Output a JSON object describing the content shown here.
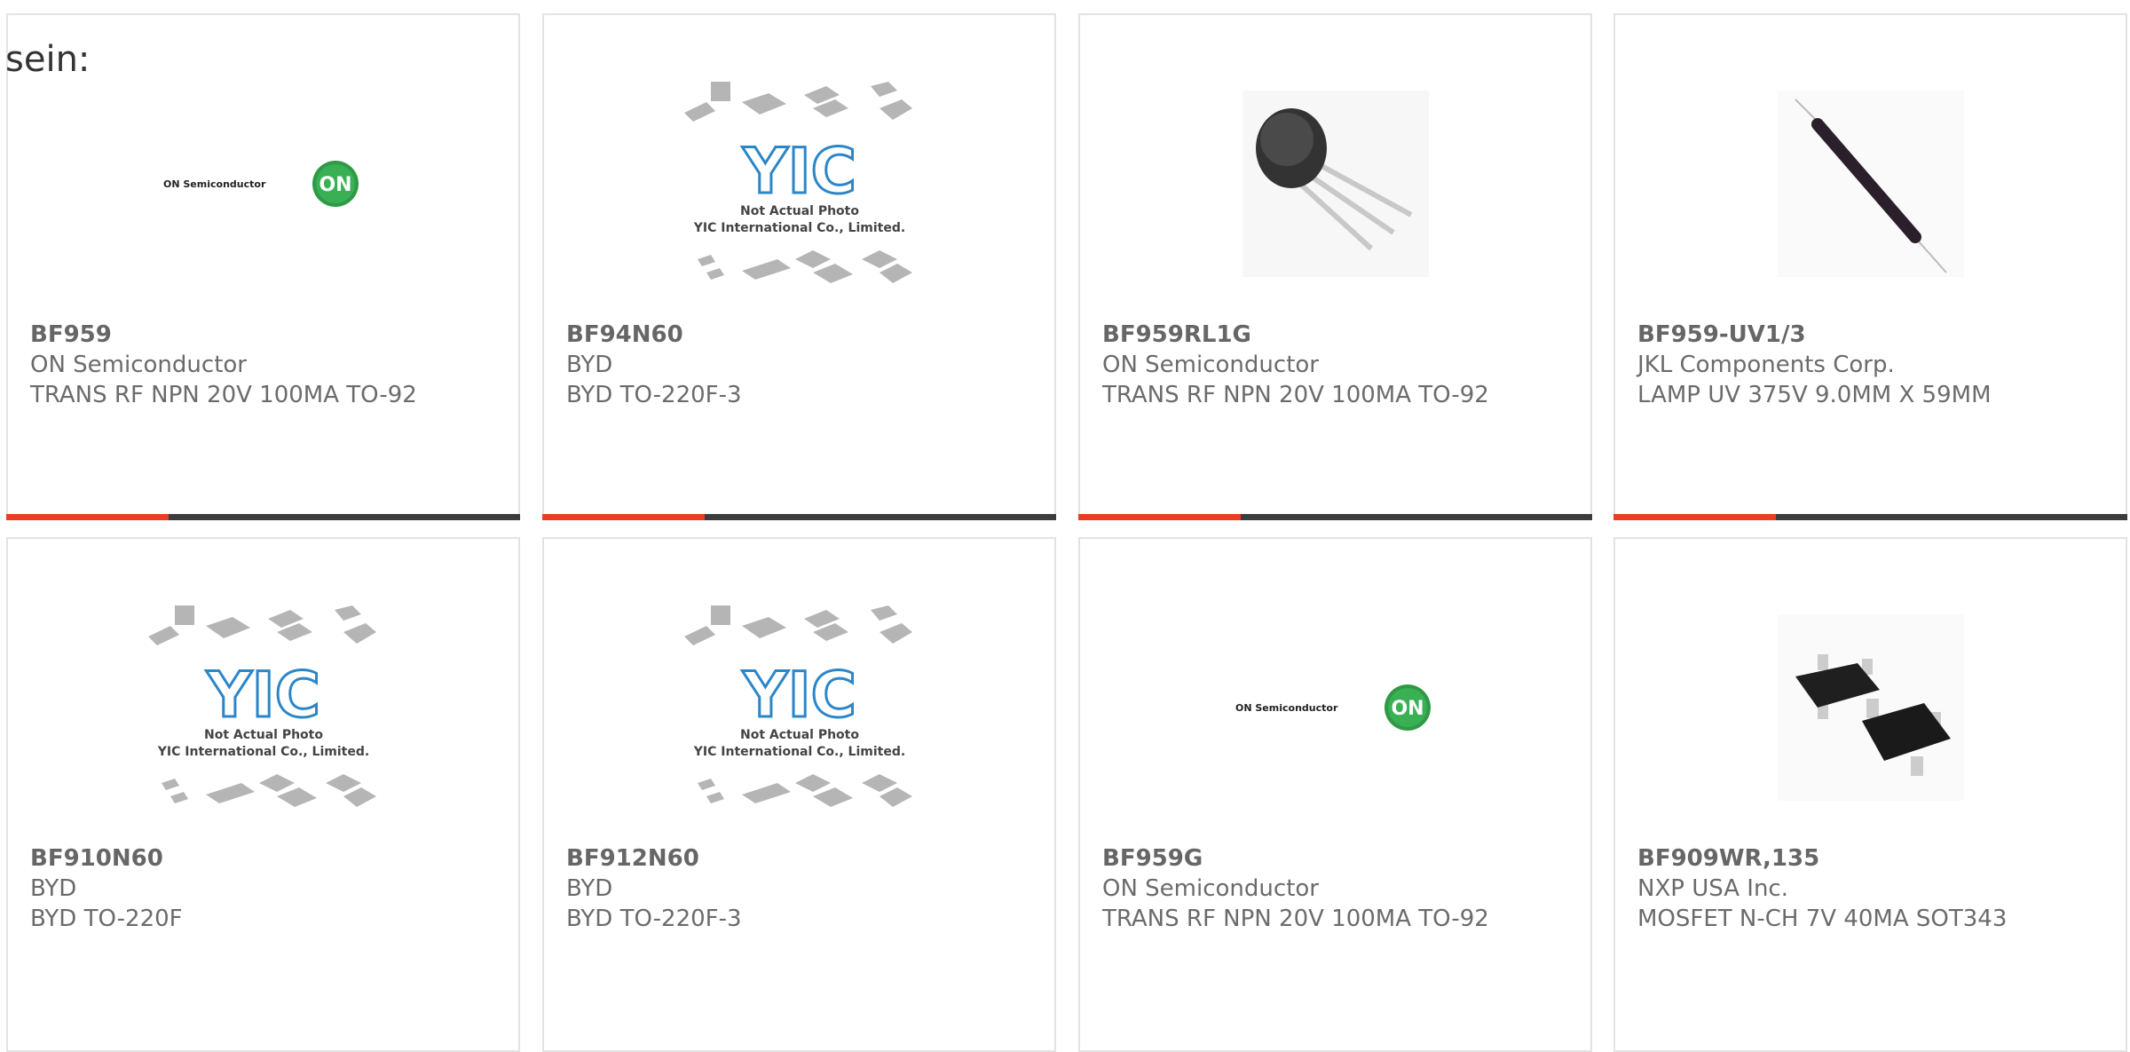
{
  "intro_text": "sein:",
  "accent_color": "#e8401c",
  "bar_color": "#3c3c3c",
  "products": [
    {
      "part": "BF959",
      "manufacturer": "ON Semiconductor",
      "description": "TRANS RF NPN 20V 100MA TO-92",
      "image": "on-semiconductor-logo"
    },
    {
      "part": "BF94N60",
      "manufacturer": "BYD",
      "description": "BYD TO-220F-3",
      "image": "yic-placeholder"
    },
    {
      "part": "BF959RL1G",
      "manufacturer": "ON Semiconductor",
      "description": "TRANS RF NPN 20V 100MA TO-92",
      "image": "to92-transistor"
    },
    {
      "part": "BF959-UV1/3",
      "manufacturer": "JKL Components Corp.",
      "description": "LAMP UV 375V 9.0MM X 59MM",
      "image": "uv-lamp"
    },
    {
      "part": "BF910N60",
      "manufacturer": "BYD",
      "description": "BYD TO-220F",
      "image": "yic-placeholder"
    },
    {
      "part": "BF912N60",
      "manufacturer": "BYD",
      "description": "BYD TO-220F-3",
      "image": "yic-placeholder"
    },
    {
      "part": "BF959G",
      "manufacturer": "ON Semiconductor",
      "description": "TRANS RF NPN 20V 100MA TO-92",
      "image": "on-semiconductor-logo"
    },
    {
      "part": "BF909WR,135",
      "manufacturer": "NXP USA Inc.",
      "description": "MOSFET N-CH 7V 40MA SOT343",
      "image": "sot343-package"
    }
  ],
  "brand": {
    "on_semi_text": "ON Semiconductor",
    "on_badge": "ON",
    "yic_logo": "YIC",
    "yic_line1": "Not Actual Photo",
    "yic_line2": "YIC International Co., Limited."
  }
}
